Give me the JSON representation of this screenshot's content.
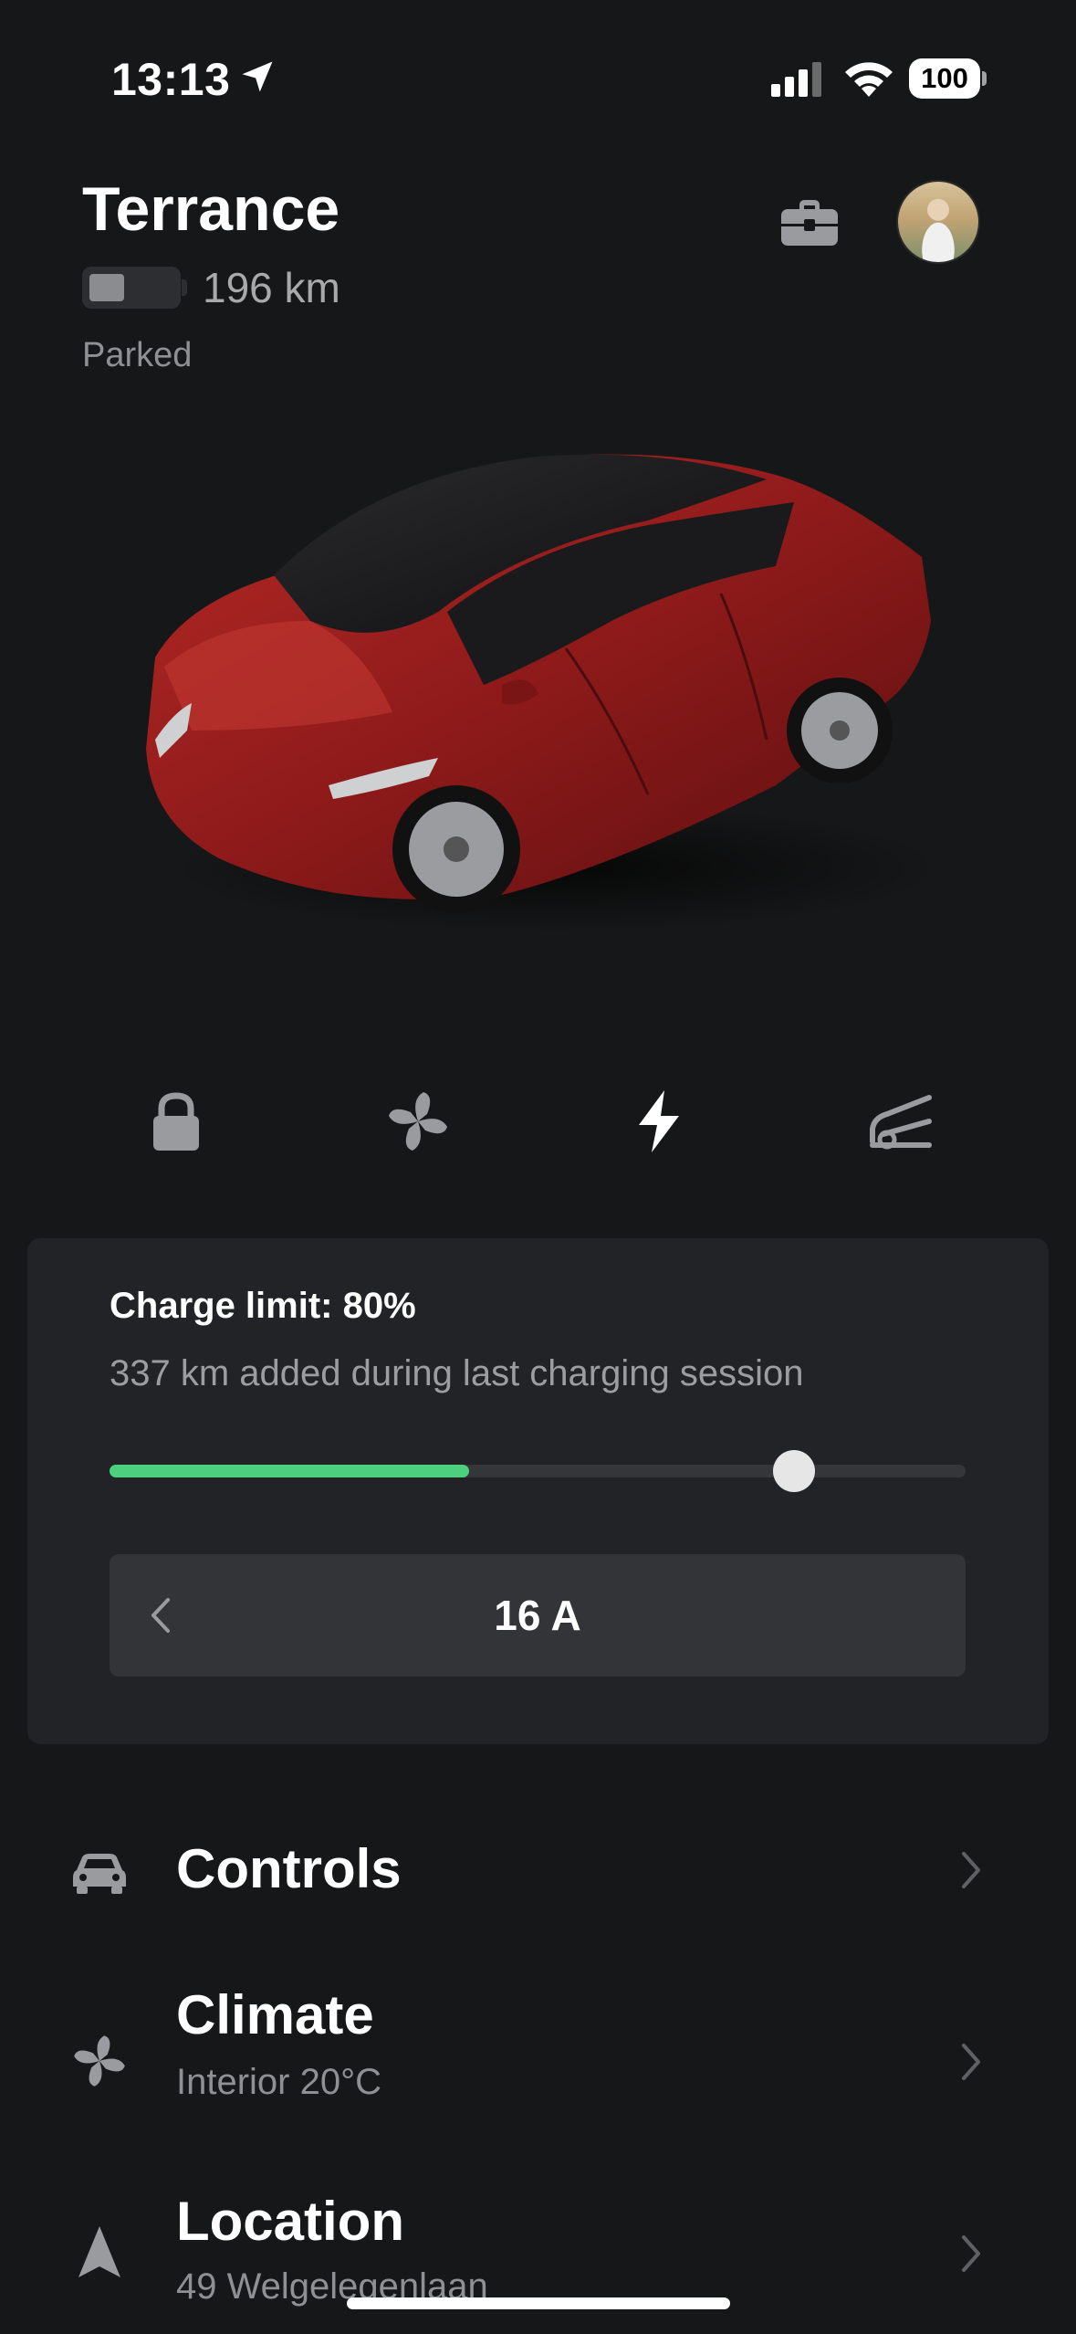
{
  "status_bar": {
    "time": "13:13",
    "battery": "100"
  },
  "header": {
    "car_name": "Terrance",
    "range": "196 km",
    "state": "Parked"
  },
  "quick_actions": [
    {
      "icon": "lock-icon"
    },
    {
      "icon": "fan-icon"
    },
    {
      "icon": "bolt-icon"
    },
    {
      "icon": "frunk-icon"
    }
  ],
  "charge": {
    "limit_label": "Charge limit: 80%",
    "added_label": "337 km added during last charging session",
    "current_level": 0.42,
    "limit_level": 0.8,
    "amps": "16 A"
  },
  "list": [
    {
      "title": "Controls",
      "subtitle": "",
      "icon": "car-icon"
    },
    {
      "title": "Climate",
      "subtitle": "Interior 20°C",
      "icon": "fan-icon"
    },
    {
      "title": "Location",
      "subtitle": "49 Welgelegenlaan",
      "icon": "navigation-arrow-icon"
    }
  ],
  "colors": {
    "background": "#161718",
    "card": "#222326",
    "charge_green": "#4cd07d",
    "car_red": "#8e1a1a"
  }
}
